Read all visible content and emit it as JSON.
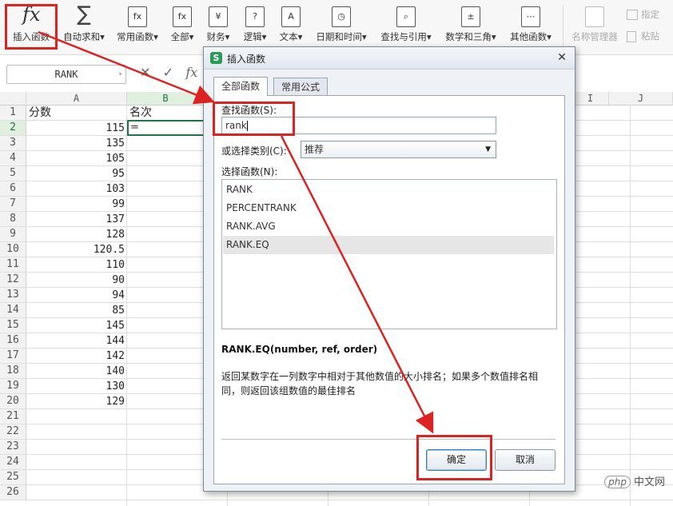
{
  "ribbon": {
    "items": [
      {
        "label": "插入函数",
        "icon": "fx-icon",
        "caret": false
      },
      {
        "label": "自动求和",
        "icon": "sigma-icon",
        "caret": true
      },
      {
        "label": "常用函数",
        "icon": "fx-star-icon",
        "caret": true
      },
      {
        "label": "全部",
        "icon": "fx-box-icon",
        "caret": true
      },
      {
        "label": "财务",
        "icon": "yen-icon",
        "caret": true
      },
      {
        "label": "逻辑",
        "icon": "question-icon",
        "caret": true
      },
      {
        "label": "文本",
        "icon": "text-a-icon",
        "caret": true
      },
      {
        "label": "日期和时间",
        "icon": "clock-icon",
        "caret": true
      },
      {
        "label": "查找与引用",
        "icon": "lookup-icon",
        "caret": true
      },
      {
        "label": "数学和三角",
        "icon": "math-icon",
        "caret": true
      },
      {
        "label": "其他函数",
        "icon": "more-icon",
        "caret": true
      }
    ],
    "disabled": {
      "name_manager": "名称管理器",
      "define": "指定",
      "paste": "粘贴"
    },
    "fx_glyph": "fx",
    "sigma_glyph": "∑",
    "icon_glyphs": [
      "fx",
      "fx",
      "¥",
      "?",
      "A",
      "◷",
      "⌕",
      "±",
      "⋯"
    ]
  },
  "formula_bar": {
    "name_box": "RANK",
    "cancel": "✕",
    "enter": "✓",
    "fx": "fx",
    "dropdown": "▾"
  },
  "sheet": {
    "columns": [
      "A",
      "B",
      "",
      "",
      "",
      "",
      "I",
      "J"
    ],
    "rows": [
      "1",
      "2",
      "3",
      "4",
      "5",
      "6",
      "7",
      "8",
      "9",
      "10",
      "11",
      "12",
      "13",
      "14",
      "15",
      "16",
      "17",
      "18",
      "19",
      "20",
      "21",
      "22",
      "23",
      "24",
      "25",
      "26"
    ],
    "header_a": "分数",
    "header_b": "名次",
    "active_cell_value": "=",
    "scores": [
      "115",
      "135",
      "105",
      "95",
      "103",
      "99",
      "137",
      "128",
      "120.5",
      "110",
      "90",
      "94",
      "85",
      "145",
      "144",
      "142",
      "140",
      "130",
      "129"
    ]
  },
  "dialog": {
    "title": "插入函数",
    "close": "✕",
    "app_icon": "S",
    "tabs": [
      "全部函数",
      "常用公式"
    ],
    "search_label": "查找函数(S):",
    "search_value": "rank",
    "category_label": "或选择类别(C):",
    "category_value": "推荐",
    "category_arrow": "▼",
    "list_label": "选择函数(N):",
    "functions": [
      "RANK",
      "PERCENTRANK",
      "RANK.AVG",
      "RANK.EQ"
    ],
    "selected_index": 3,
    "signature": "RANK.EQ(number, ref, order)",
    "description": "返回某数字在一列数字中相对于其他数值的大小排名；如果多个数值排名相同，则返回该组数值的最佳排名",
    "ok": "确定",
    "cancel": "取消"
  },
  "watermark": {
    "badge": "php",
    "text": "中文网"
  },
  "colors": {
    "annotation_red": "#dd2222",
    "selection_green": "#217346"
  }
}
